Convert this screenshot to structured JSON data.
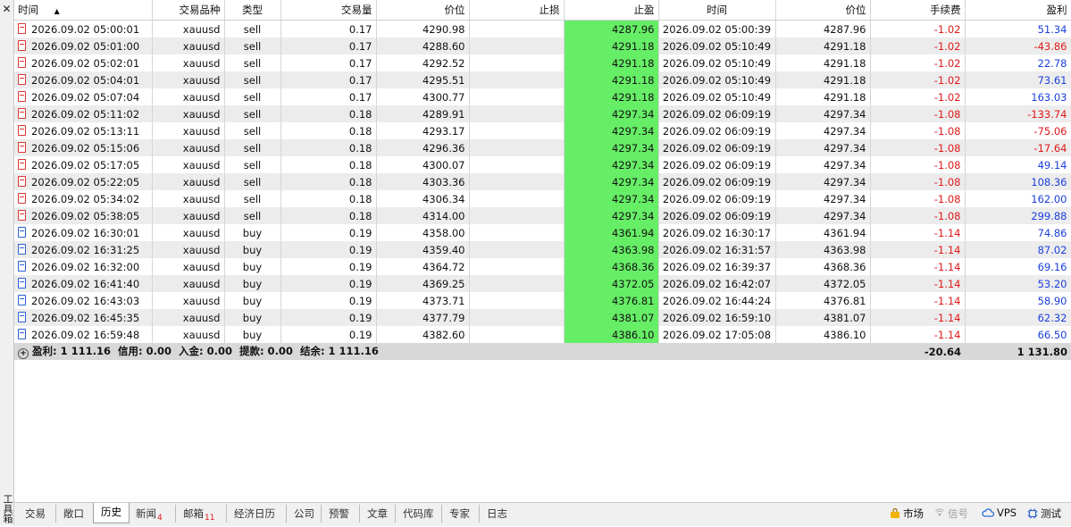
{
  "toolbox": {
    "close_label": "✕",
    "title": "工具箱"
  },
  "columns": [
    "时间",
    "交易品种",
    "类型",
    "交易量",
    "价位",
    "止损",
    "止盈",
    "时间",
    "价位",
    "手续费",
    "盈利"
  ],
  "rows": [
    {
      "open_time": "2026.09.02 05:00:01",
      "symbol": "xauusd",
      "type": "sell",
      "volume": "0.17",
      "price": "4290.98",
      "sl": "",
      "tp": "4287.96",
      "close_time": "2026.09.02 05:00:39",
      "close_price": "4287.96",
      "commission": "-1.02",
      "profit": "51.34",
      "profit_sign": "pos"
    },
    {
      "open_time": "2026.09.02 05:01:00",
      "symbol": "xauusd",
      "type": "sell",
      "volume": "0.17",
      "price": "4288.60",
      "sl": "",
      "tp": "4291.18",
      "close_time": "2026.09.02 05:10:49",
      "close_price": "4291.18",
      "commission": "-1.02",
      "profit": "-43.86",
      "profit_sign": "neg"
    },
    {
      "open_time": "2026.09.02 05:02:01",
      "symbol": "xauusd",
      "type": "sell",
      "volume": "0.17",
      "price": "4292.52",
      "sl": "",
      "tp": "4291.18",
      "close_time": "2026.09.02 05:10:49",
      "close_price": "4291.18",
      "commission": "-1.02",
      "profit": "22.78",
      "profit_sign": "pos"
    },
    {
      "open_time": "2026.09.02 05:04:01",
      "symbol": "xauusd",
      "type": "sell",
      "volume": "0.17",
      "price": "4295.51",
      "sl": "",
      "tp": "4291.18",
      "close_time": "2026.09.02 05:10:49",
      "close_price": "4291.18",
      "commission": "-1.02",
      "profit": "73.61",
      "profit_sign": "pos"
    },
    {
      "open_time": "2026.09.02 05:07:04",
      "symbol": "xauusd",
      "type": "sell",
      "volume": "0.17",
      "price": "4300.77",
      "sl": "",
      "tp": "4291.18",
      "close_time": "2026.09.02 05:10:49",
      "close_price": "4291.18",
      "commission": "-1.02",
      "profit": "163.03",
      "profit_sign": "pos"
    },
    {
      "open_time": "2026.09.02 05:11:02",
      "symbol": "xauusd",
      "type": "sell",
      "volume": "0.18",
      "price": "4289.91",
      "sl": "",
      "tp": "4297.34",
      "close_time": "2026.09.02 06:09:19",
      "close_price": "4297.34",
      "commission": "-1.08",
      "profit": "-133.74",
      "profit_sign": "neg"
    },
    {
      "open_time": "2026.09.02 05:13:11",
      "symbol": "xauusd",
      "type": "sell",
      "volume": "0.18",
      "price": "4293.17",
      "sl": "",
      "tp": "4297.34",
      "close_time": "2026.09.02 06:09:19",
      "close_price": "4297.34",
      "commission": "-1.08",
      "profit": "-75.06",
      "profit_sign": "neg"
    },
    {
      "open_time": "2026.09.02 05:15:06",
      "symbol": "xauusd",
      "type": "sell",
      "volume": "0.18",
      "price": "4296.36",
      "sl": "",
      "tp": "4297.34",
      "close_time": "2026.09.02 06:09:19",
      "close_price": "4297.34",
      "commission": "-1.08",
      "profit": "-17.64",
      "profit_sign": "neg"
    },
    {
      "open_time": "2026.09.02 05:17:05",
      "symbol": "xauusd",
      "type": "sell",
      "volume": "0.18",
      "price": "4300.07",
      "sl": "",
      "tp": "4297.34",
      "close_time": "2026.09.02 06:09:19",
      "close_price": "4297.34",
      "commission": "-1.08",
      "profit": "49.14",
      "profit_sign": "pos"
    },
    {
      "open_time": "2026.09.02 05:22:05",
      "symbol": "xauusd",
      "type": "sell",
      "volume": "0.18",
      "price": "4303.36",
      "sl": "",
      "tp": "4297.34",
      "close_time": "2026.09.02 06:09:19",
      "close_price": "4297.34",
      "commission": "-1.08",
      "profit": "108.36",
      "profit_sign": "pos"
    },
    {
      "open_time": "2026.09.02 05:34:02",
      "symbol": "xauusd",
      "type": "sell",
      "volume": "0.18",
      "price": "4306.34",
      "sl": "",
      "tp": "4297.34",
      "close_time": "2026.09.02 06:09:19",
      "close_price": "4297.34",
      "commission": "-1.08",
      "profit": "162.00",
      "profit_sign": "pos"
    },
    {
      "open_time": "2026.09.02 05:38:05",
      "symbol": "xauusd",
      "type": "sell",
      "volume": "0.18",
      "price": "4314.00",
      "sl": "",
      "tp": "4297.34",
      "close_time": "2026.09.02 06:09:19",
      "close_price": "4297.34",
      "commission": "-1.08",
      "profit": "299.88",
      "profit_sign": "pos"
    },
    {
      "open_time": "2026.09.02 16:30:01",
      "symbol": "xauusd",
      "type": "buy",
      "volume": "0.19",
      "price": "4358.00",
      "sl": "",
      "tp": "4361.94",
      "close_time": "2026.09.02 16:30:17",
      "close_price": "4361.94",
      "commission": "-1.14",
      "profit": "74.86",
      "profit_sign": "pos"
    },
    {
      "open_time": "2026.09.02 16:31:25",
      "symbol": "xauusd",
      "type": "buy",
      "volume": "0.19",
      "price": "4359.40",
      "sl": "",
      "tp": "4363.98",
      "close_time": "2026.09.02 16:31:57",
      "close_price": "4363.98",
      "commission": "-1.14",
      "profit": "87.02",
      "profit_sign": "pos"
    },
    {
      "open_time": "2026.09.02 16:32:00",
      "symbol": "xauusd",
      "type": "buy",
      "volume": "0.19",
      "price": "4364.72",
      "sl": "",
      "tp": "4368.36",
      "close_time": "2026.09.02 16:39:37",
      "close_price": "4368.36",
      "commission": "-1.14",
      "profit": "69.16",
      "profit_sign": "pos"
    },
    {
      "open_time": "2026.09.02 16:41:40",
      "symbol": "xauusd",
      "type": "buy",
      "volume": "0.19",
      "price": "4369.25",
      "sl": "",
      "tp": "4372.05",
      "close_time": "2026.09.02 16:42:07",
      "close_price": "4372.05",
      "commission": "-1.14",
      "profit": "53.20",
      "profit_sign": "pos"
    },
    {
      "open_time": "2026.09.02 16:43:03",
      "symbol": "xauusd",
      "type": "buy",
      "volume": "0.19",
      "price": "4373.71",
      "sl": "",
      "tp": "4376.81",
      "close_time": "2026.09.02 16:44:24",
      "close_price": "4376.81",
      "commission": "-1.14",
      "profit": "58.90",
      "profit_sign": "pos"
    },
    {
      "open_time": "2026.09.02 16:45:35",
      "symbol": "xauusd",
      "type": "buy",
      "volume": "0.19",
      "price": "4377.79",
      "sl": "",
      "tp": "4381.07",
      "close_time": "2026.09.02 16:59:10",
      "close_price": "4381.07",
      "commission": "-1.14",
      "profit": "62.32",
      "profit_sign": "pos"
    },
    {
      "open_time": "2026.09.02 16:59:48",
      "symbol": "xauusd",
      "type": "buy",
      "volume": "0.19",
      "price": "4382.60",
      "sl": "",
      "tp": "4386.10",
      "close_time": "2026.09.02 17:05:08",
      "close_price": "4386.10",
      "commission": "-1.14",
      "profit": "66.50",
      "profit_sign": "pos"
    }
  ],
  "summary": {
    "text": "盈利: 1 111.16  信用: 0.00  入金: 0.00  提款: 0.00  结余: 1 111.16",
    "commission_total": "-20.64",
    "profit_total": "1 131.80"
  },
  "tabs": [
    {
      "label": "交易",
      "badge": ""
    },
    {
      "label": "敞口",
      "badge": ""
    },
    {
      "label": "历史",
      "badge": "",
      "active": true
    },
    {
      "label": "新闻",
      "badge": "4"
    },
    {
      "label": "邮箱",
      "badge": "11"
    },
    {
      "label": "经济日历",
      "badge": ""
    },
    {
      "label": "公司",
      "badge": ""
    },
    {
      "label": "预警",
      "badge": ""
    },
    {
      "label": "文章",
      "badge": ""
    },
    {
      "label": "代码库",
      "badge": ""
    },
    {
      "label": "专家",
      "badge": ""
    },
    {
      "label": "日志",
      "badge": ""
    }
  ],
  "status": {
    "market": "市场",
    "signals": "信号",
    "vps": "VPS",
    "tester": "测试"
  },
  "colors": {
    "tp_highlight": "#66ee66",
    "loss": "#e01818",
    "gain": "#1a3fdd",
    "sell_icon": "#dd3333",
    "buy_icon": "#2a5fd0"
  },
  "icons": {
    "sell_order": "doc-red-icon",
    "buy_order": "doc-blue-icon",
    "summary": "plus-circle-icon",
    "sort": "sort-ascending-icon"
  }
}
